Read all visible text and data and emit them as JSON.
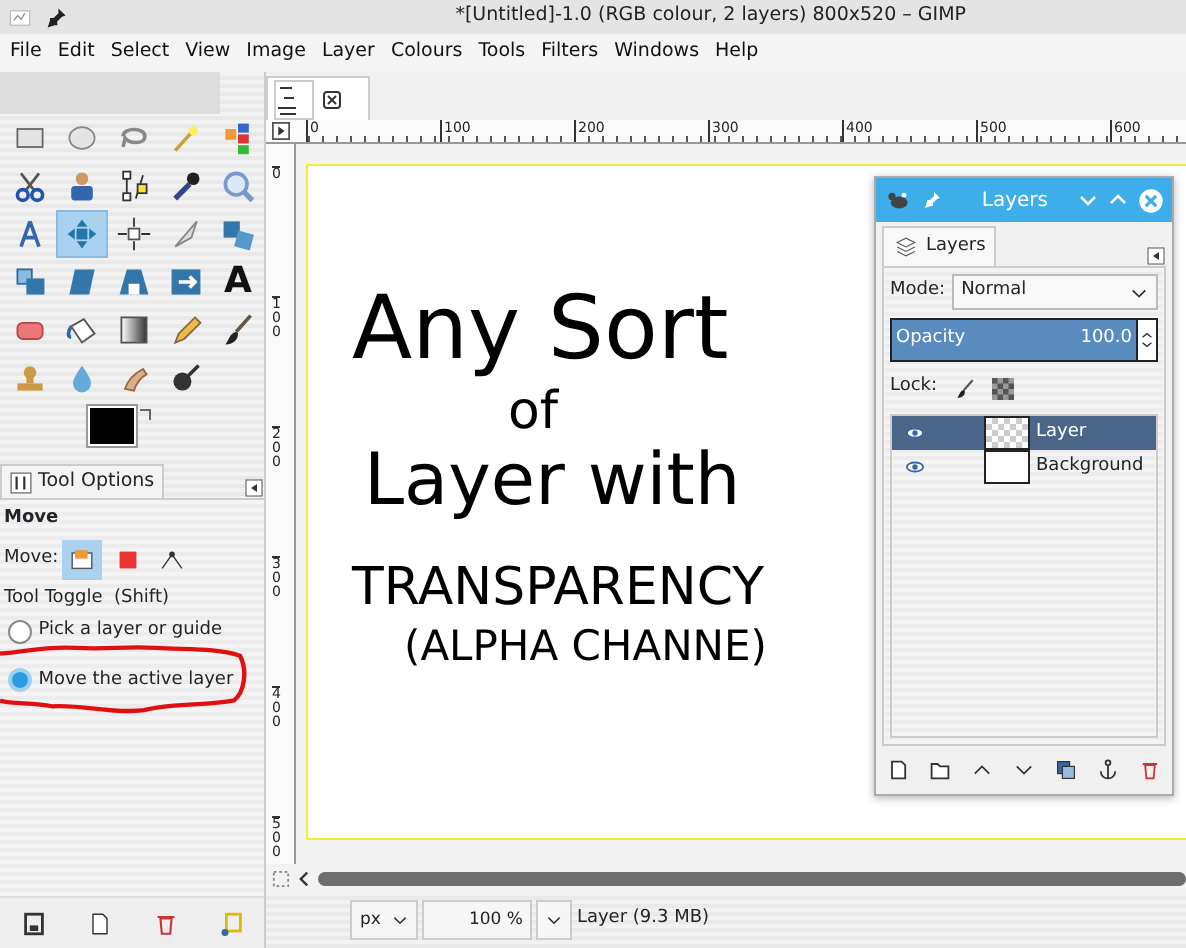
{
  "window": {
    "title": "*[Untitled]-1.0 (RGB colour, 2 layers) 800x520 – GIMP"
  },
  "menu": [
    "File",
    "Edit",
    "Select",
    "View",
    "Image",
    "Layer",
    "Colours",
    "Tools",
    "Filters",
    "Windows",
    "Help"
  ],
  "toolbox": {
    "tools": [
      {
        "selected": false
      },
      {
        "selected": false
      },
      {
        "selected": false
      },
      {
        "selected": false
      },
      {
        "selected": false
      },
      {
        "selected": false
      },
      {
        "selected": false
      },
      {
        "selected": false
      },
      {
        "selected": false
      },
      {
        "selected": false
      },
      {
        "selected": false
      },
      {
        "selected": true
      },
      {
        "selected": false
      },
      {
        "selected": false
      },
      {
        "selected": false
      },
      {
        "selected": false
      },
      {
        "selected": false
      },
      {
        "selected": false
      },
      {
        "selected": false
      },
      {
        "selected": false,
        "glyph": "A"
      },
      {
        "selected": false
      },
      {
        "selected": false
      },
      {
        "selected": false
      },
      {
        "selected": false
      },
      {
        "selected": false
      },
      {
        "selected": false
      },
      {
        "selected": false
      },
      {
        "selected": false
      },
      {
        "selected": false
      }
    ]
  },
  "tool_options": {
    "tab": "Tool Options",
    "heading": "Move",
    "move_label": "Move:",
    "move_modes": [
      {
        "selected": true
      },
      {
        "selected": false
      },
      {
        "selected": false
      }
    ],
    "toggle_label": "Tool Toggle  (Shift)",
    "options": [
      {
        "label": "Pick a layer or guide",
        "selected": false
      },
      {
        "label": "Move the active layer",
        "selected": true
      }
    ]
  },
  "image_window": {
    "top_ruler": [
      "0",
      "100",
      "200",
      "300",
      "400",
      "500",
      "600"
    ],
    "left_ruler": [
      "0",
      "100",
      "200",
      "300",
      "400",
      "500"
    ],
    "drawing_text": [
      "Any Sort",
      "of",
      "Layer with",
      "TRANSPARENCY",
      "(ALPHA CHANNE)"
    ],
    "status": {
      "unit": "px",
      "zoom": "100 %",
      "info": "Layer (9.3 MB)"
    }
  },
  "layers_dock": {
    "title": "Layers",
    "tab": "Layers",
    "mode_label": "Mode:",
    "mode": "Normal",
    "opacity_label": "Opacity",
    "opacity": "100.0",
    "level": 1.0,
    "lock_label": "Lock:",
    "layers": [
      {
        "name": "Layer",
        "visible": true,
        "selected": true,
        "kind": "transparent"
      },
      {
        "name": "Background",
        "visible": true,
        "selected": false,
        "kind": "opaque"
      }
    ]
  }
}
